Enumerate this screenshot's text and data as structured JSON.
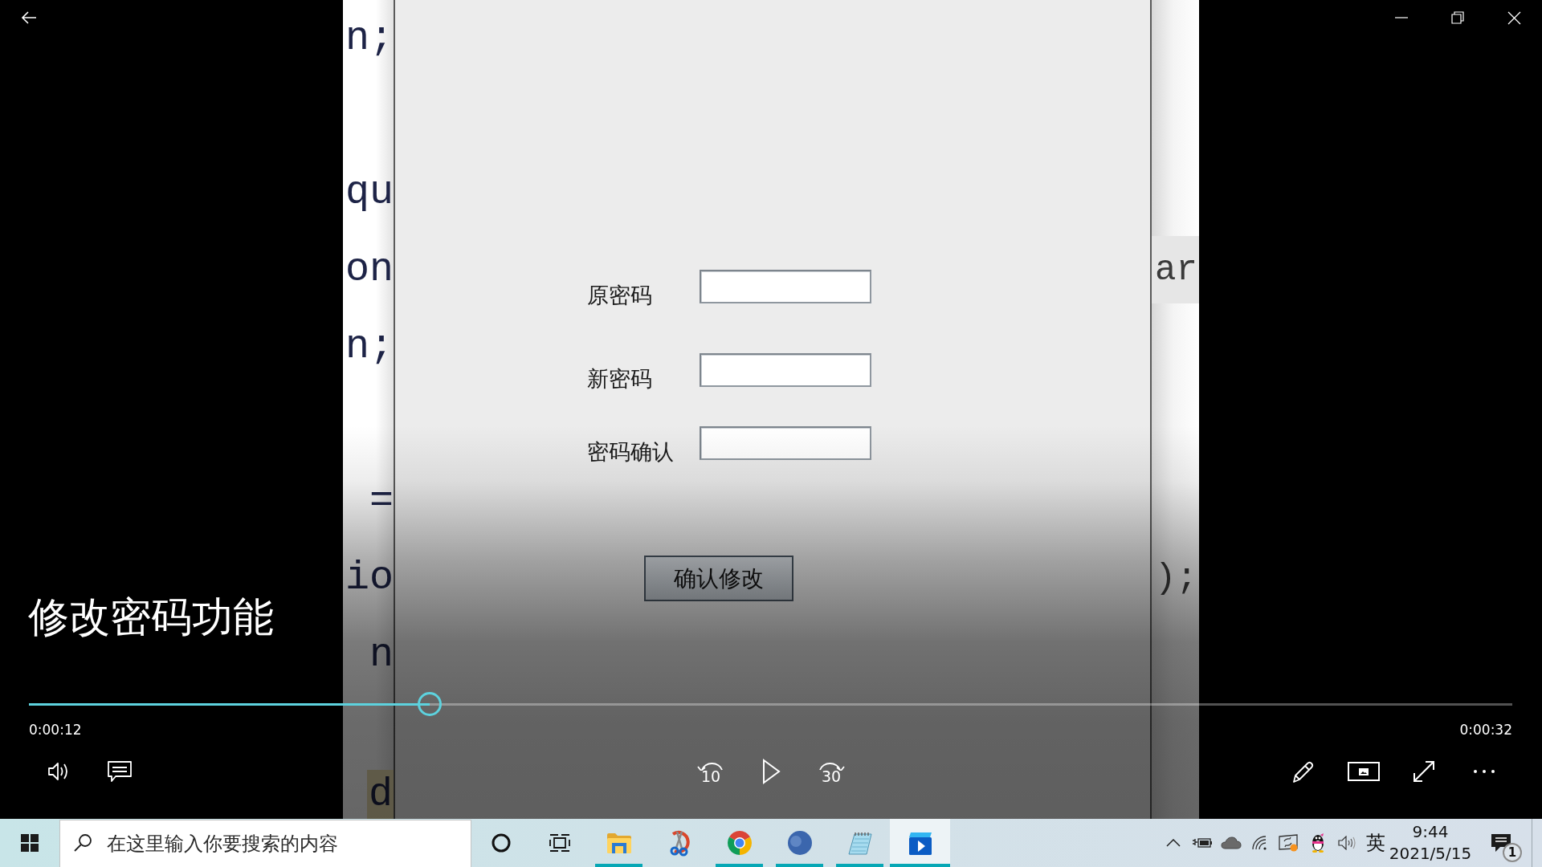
{
  "video": {
    "code_left": [
      {
        "text": "n;",
        "highlighted": false
      },
      {
        "text": "qu",
        "highlighted": false
      },
      {
        "text": "on",
        "highlighted": false
      },
      {
        "text": "n;",
        "highlighted": false
      },
      {
        "text": "=",
        "highlighted": false
      },
      {
        "text": "io",
        "highlighted": false
      },
      {
        "text": "n",
        "highlighted": false
      },
      {
        "text": "d",
        "highlighted": true
      }
    ],
    "dialog": {
      "fields": [
        {
          "label": "原密码"
        },
        {
          "label": "新密码"
        },
        {
          "label": "密码确认"
        }
      ],
      "button": "确认修改"
    },
    "code_right": [
      {
        "text": "ar",
        "highlighted": true
      },
      {
        "text": ");",
        "highlighted": false
      }
    ]
  },
  "player": {
    "title": "修改密码功能",
    "progress": {
      "level": 0.27
    },
    "elapsed": "0:00:12",
    "duration": "0:00:32",
    "skip_back_label": "10",
    "playing": false,
    "skip_forward_label": "30"
  },
  "taskbar": {
    "search": {
      "placeholder": "在这里输入你要搜索的内容"
    },
    "apps": [
      {
        "kind": "folder",
        "running": true,
        "selected": false
      },
      {
        "kind": "scissors",
        "running": false,
        "selected": false
      },
      {
        "kind": "browser",
        "running": true,
        "selected": false
      },
      {
        "kind": "round_app",
        "running": true,
        "selected": false
      },
      {
        "kind": "notepad",
        "running": true,
        "selected": false
      },
      {
        "kind": "player",
        "running": true,
        "selected": true
      }
    ],
    "input_method": "英",
    "clock": {
      "time": "9:44",
      "date": "2021/5/15"
    },
    "notifications": {
      "count": "1"
    }
  }
}
